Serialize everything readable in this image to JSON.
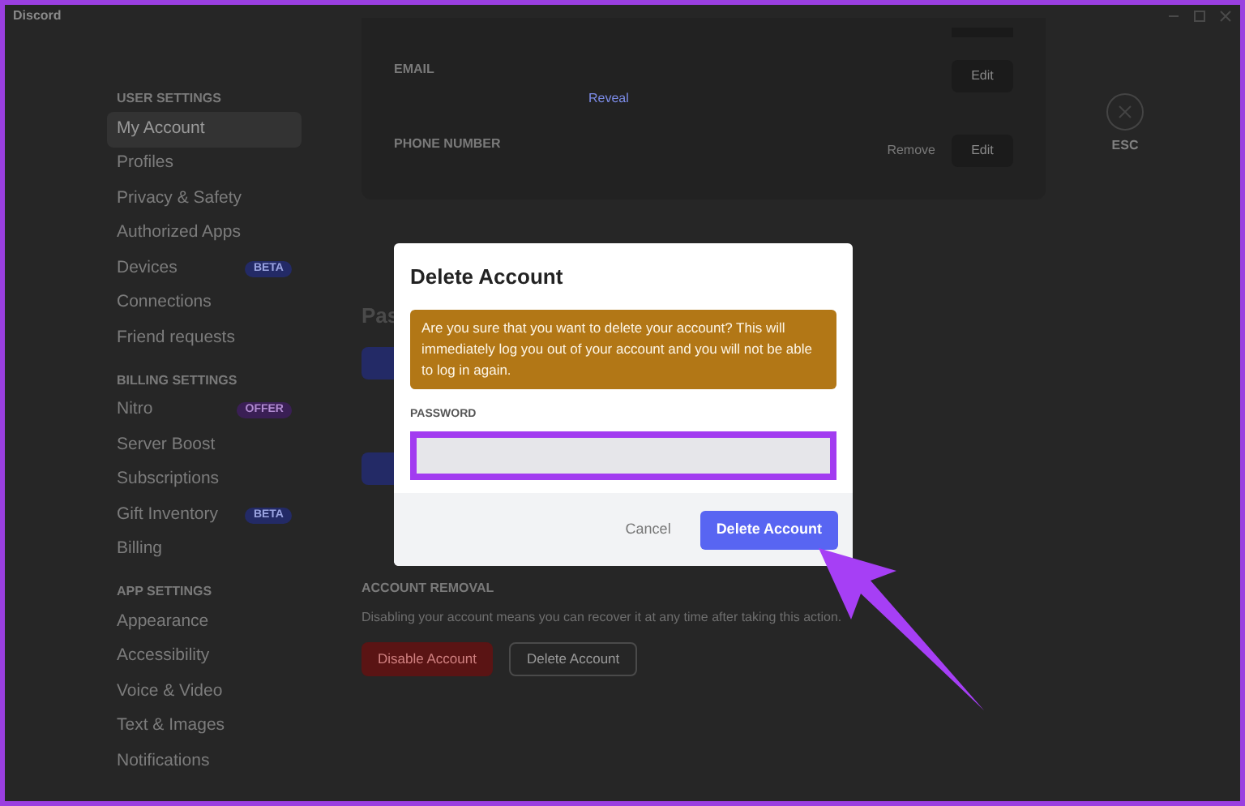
{
  "window": {
    "title": "Discord"
  },
  "sidebar": {
    "sections": [
      {
        "heading": "USER SETTINGS",
        "items": [
          {
            "label": "My Account",
            "selected": true
          },
          {
            "label": "Profiles",
            "selected": false
          },
          {
            "label": "Privacy & Safety",
            "selected": false
          },
          {
            "label": "Authorized Apps",
            "selected": false
          },
          {
            "label": "Devices",
            "badge": "BETA",
            "selected": false
          },
          {
            "label": "Connections",
            "selected": false
          },
          {
            "label": "Friend requests",
            "selected": false
          }
        ]
      },
      {
        "heading": "BILLING SETTINGS",
        "items": [
          {
            "label": "Nitro",
            "badge": "OFFER",
            "selected": false
          },
          {
            "label": "Server Boost",
            "selected": false
          },
          {
            "label": "Subscriptions",
            "selected": false
          },
          {
            "label": "Gift Inventory",
            "badge": "BETA",
            "selected": false
          },
          {
            "label": "Billing",
            "selected": false
          }
        ]
      },
      {
        "heading": "APP SETTINGS",
        "items": [
          {
            "label": "Appearance",
            "selected": false
          },
          {
            "label": "Accessibility",
            "selected": false
          },
          {
            "label": "Voice & Video",
            "selected": false
          },
          {
            "label": "Text & Images",
            "selected": false
          },
          {
            "label": "Notifications",
            "selected": false
          }
        ]
      }
    ]
  },
  "account_card": {
    "email_label": "EMAIL",
    "reveal_link": "Reveal",
    "phone_label": "PHONE NUMBER",
    "remove_link": "Remove",
    "edit_buttons": [
      "Edit",
      "Edit"
    ]
  },
  "close": {
    "label": "ESC"
  },
  "password_heading": "Pas",
  "account_removal": {
    "heading": "ACCOUNT REMOVAL",
    "description": "Disabling your account means you can recover it at any time after taking this action.",
    "buttons": [
      "Disable Account",
      "Delete Account"
    ]
  },
  "dialog": {
    "title": "Delete Account",
    "warning": "Are you sure that you want to delete your account? This will immediately log you out of your account and you will not be able to log in again.",
    "password_label": "PASSWORD",
    "cancel": "Cancel",
    "confirm": "Delete Account"
  }
}
